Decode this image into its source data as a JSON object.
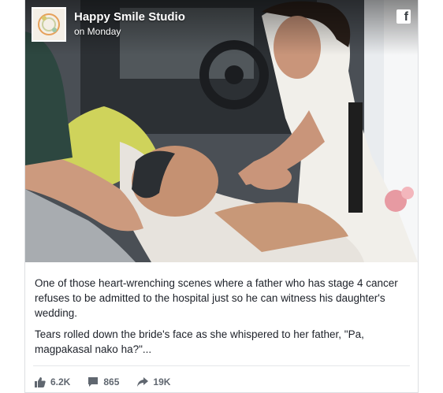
{
  "post": {
    "page_name": "Happy Smile Studio",
    "time": "on Monday",
    "caption_1": "One of those heart-wrenching scenes where a father who has stage 4 cancer refuses to be admitted to the hospital just so he can witness his daughter's wedding.",
    "caption_2": "Tears rolled down the bride's face as she whispered to her father, \"Pa, magpakasal nako ha?\"...",
    "likes": "6.2K",
    "comments": "865",
    "shares": "19K"
  },
  "icons": {
    "avatar": "studio-logo",
    "network": "facebook-icon",
    "like": "thumbs-up-icon",
    "comment": "comment-bubble-icon",
    "share": "share-arrow-icon"
  },
  "colors": {
    "text": "#1d2129",
    "meta": "#606770",
    "border": "#dddfe2"
  }
}
